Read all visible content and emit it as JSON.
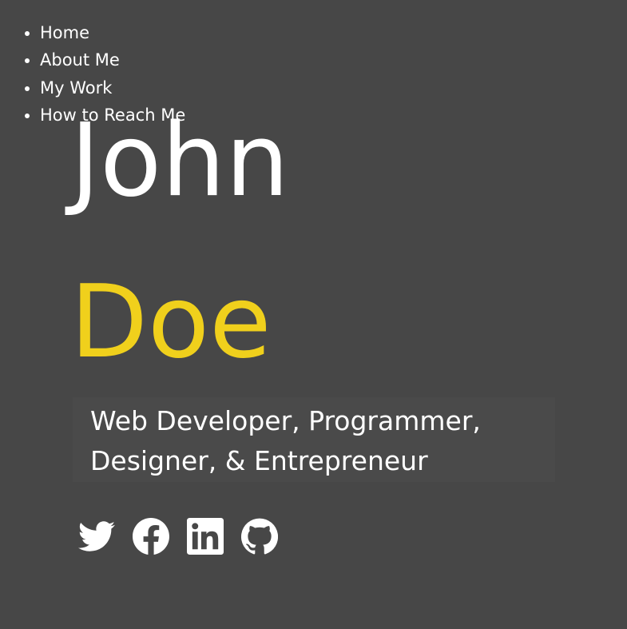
{
  "nav": {
    "items": [
      {
        "label": "Home"
      },
      {
        "label": "About Me"
      },
      {
        "label": "My Work"
      },
      {
        "label": "How to Reach Me"
      }
    ]
  },
  "hero": {
    "first_name": "John",
    "last_name": "Doe",
    "tagline": "Web Developer, Programmer, Designer, & Entrepreneur"
  },
  "social": {
    "icons": [
      "twitter-icon",
      "facebook-icon",
      "linkedin-icon",
      "github-icon"
    ]
  },
  "colors": {
    "background": "#474747",
    "accent": "#f0d01c",
    "text": "#ffffff"
  }
}
